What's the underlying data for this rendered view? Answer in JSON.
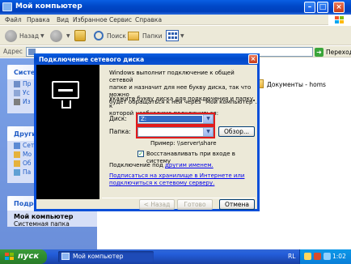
{
  "window": {
    "title": "Мой компьютер"
  },
  "menu": [
    "Файл",
    "Правка",
    "Вид",
    "Избранное",
    "Сервис",
    "Справка"
  ],
  "toolbar": {
    "back": "Назад",
    "search": "Поиск",
    "folders": "Папки"
  },
  "address": {
    "label": "Адрес",
    "go": "Переход"
  },
  "left_pane": {
    "system_tasks": {
      "header": "Систе",
      "items": [
        "Пр",
        "Ус",
        "Из"
      ]
    },
    "other_places": {
      "header": "Други",
      "items": [
        "Сет",
        "Мо",
        "Об",
        "Па"
      ]
    },
    "details": {
      "header": "Подро",
      "title": "Мой компьютер",
      "subtitle": "Системная папка"
    }
  },
  "content": {
    "item": "Документы - homs"
  },
  "dialog": {
    "title": "Подключение сетевого диска",
    "intro": [
      "Windows выполнит подключение к общей сетевой",
      "папке и назначит для нее букву диска, так что можно",
      "будет обращаться к ней через \"Мой компьютер\"."
    ],
    "instruction": [
      "Укажите букву диска для подключения и папку, к",
      "которой необходимо подключиться:"
    ],
    "drive_label": "Диск:",
    "drive_value": "Z:",
    "folder_label": "Папка:",
    "folder_value": "",
    "browse_button": "Обзор...",
    "example": "Пример: \\\\server\\share",
    "reconnect_label": "Восстанавливать при входе в систему",
    "reconnect_checked": true,
    "other_user_text": "Подключение под ",
    "other_user_link": "другим именем.",
    "storage_link_1": "Подписаться на хранилище в Интернете или",
    "storage_link_2": "подключиться к сетевому серверу.",
    "back_button": "< Назад",
    "finish_button": "Готово",
    "cancel_button": "Отмена"
  },
  "taskbar": {
    "start": "пуск",
    "window_button": "Мой компьютер",
    "lang": "RL",
    "clock": "1:02"
  }
}
